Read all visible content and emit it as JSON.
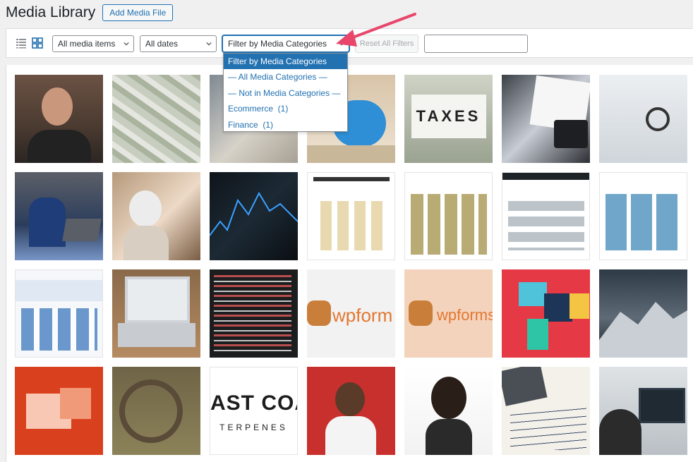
{
  "header": {
    "title": "Media Library",
    "add_button": "Add Media File"
  },
  "toolbar": {
    "media_type_filter": "All media items",
    "date_filter": "All dates",
    "category_filter": "Filter by Media Categories",
    "reset_button": "Reset All Filters",
    "search_value": ""
  },
  "dropdown": {
    "options": [
      {
        "label": "Filter by Media Categories",
        "selected": true
      },
      {
        "label": "— All Media Categories —",
        "selected": false
      },
      {
        "label": "— Not in Media Categories —",
        "selected": false
      },
      {
        "label": "Ecommerce  (1)",
        "selected": false
      },
      {
        "label": "Finance  (1)",
        "selected": false
      }
    ]
  },
  "thumbnails": {
    "row3_col4_text": "wpform",
    "row3_col5_text": "wpforms",
    "row4_col3_text_line1": "AST COAS",
    "row4_col3_text_line2": "TERPENES",
    "row1_col5_text": "TAXES"
  },
  "colors": {
    "accent": "#2271b1",
    "arrow": "#e8466a"
  }
}
